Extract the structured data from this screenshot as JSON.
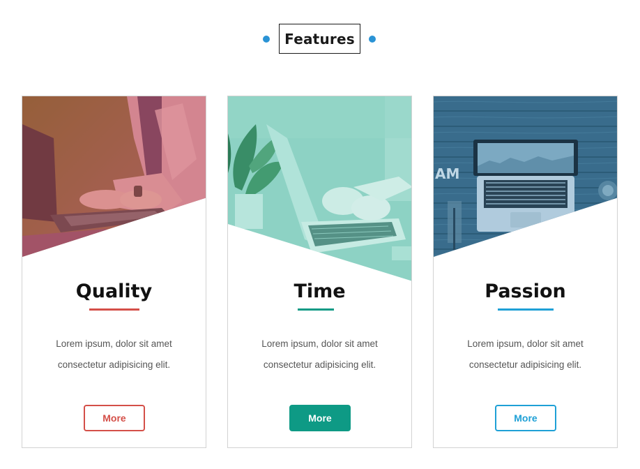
{
  "header": {
    "title": "Features",
    "dot_color": "#2a93d5"
  },
  "cards": [
    {
      "title": "Quality",
      "desc_line1": "Lorem ipsum, dolor sit amet",
      "desc_line2": "consectetur adipisicing elit.",
      "button_label": "More",
      "accent": "#d44f48",
      "button_style": "outline",
      "image": "woman-typing-on-laptop"
    },
    {
      "title": "Time",
      "desc_line1": "Lorem ipsum, dolor sit amet",
      "desc_line2": "consectetur adipisicing elit.",
      "button_label": "More",
      "accent": "#0e9a85",
      "button_style": "filled",
      "image": "hands-typing-with-plant"
    },
    {
      "title": "Passion",
      "desc_line1": "Lorem ipsum, dolor sit amet",
      "desc_line2": "consectetur adipisicing elit.",
      "button_label": "More",
      "accent": "#1ea0d6",
      "button_style": "outline",
      "image": "laptop-on-wooden-desk"
    }
  ]
}
